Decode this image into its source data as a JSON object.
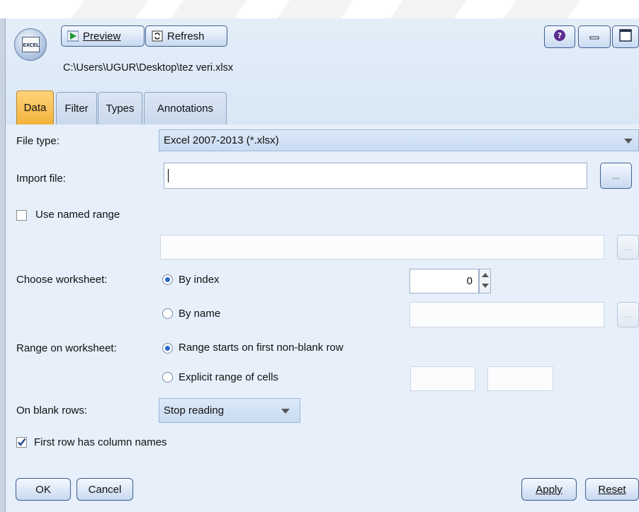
{
  "toolbar": {
    "excel_icon_text": "EXCEL",
    "preview_label": "Preview",
    "refresh_label": "Refresh"
  },
  "window": {
    "file_path": "C:\\Users\\UGUR\\Desktop\\tez veri.xlsx"
  },
  "tabs": [
    {
      "label": "Data",
      "active": true
    },
    {
      "label": "Filter",
      "active": false
    },
    {
      "label": "Types",
      "active": false
    },
    {
      "label": "Annotations",
      "active": false
    }
  ],
  "form": {
    "file_type_label": "File type:",
    "file_type_value": "Excel 2007-2013 (*.xlsx)",
    "import_file_label": "Import file:",
    "import_file_value": "",
    "browse_label": "...",
    "use_named_range_label": "Use named range",
    "use_named_range_checked": false,
    "named_range_value": "",
    "choose_worksheet_label": "Choose worksheet:",
    "by_index_label": "By index",
    "by_index_value": "0",
    "by_name_label": "By name",
    "by_name_value": "",
    "range_label": "Range on worksheet:",
    "range_first_nonblank_label": "Range starts on first non-blank row",
    "range_explicit_label": "Explicit range of cells",
    "blank_rows_label": "On blank rows:",
    "blank_rows_value": "Stop reading",
    "first_row_names_label": "First row has column names",
    "first_row_names_checked": true
  },
  "footer": {
    "ok_label": "OK",
    "cancel_label": "Cancel",
    "apply_label": "Apply",
    "reset_label": "Reset"
  },
  "colors": {
    "panel_bg": "#e6effa",
    "active_tab": "#f3b23c",
    "button_border": "#3f5f91",
    "help_icon": "#5b2c8f"
  }
}
